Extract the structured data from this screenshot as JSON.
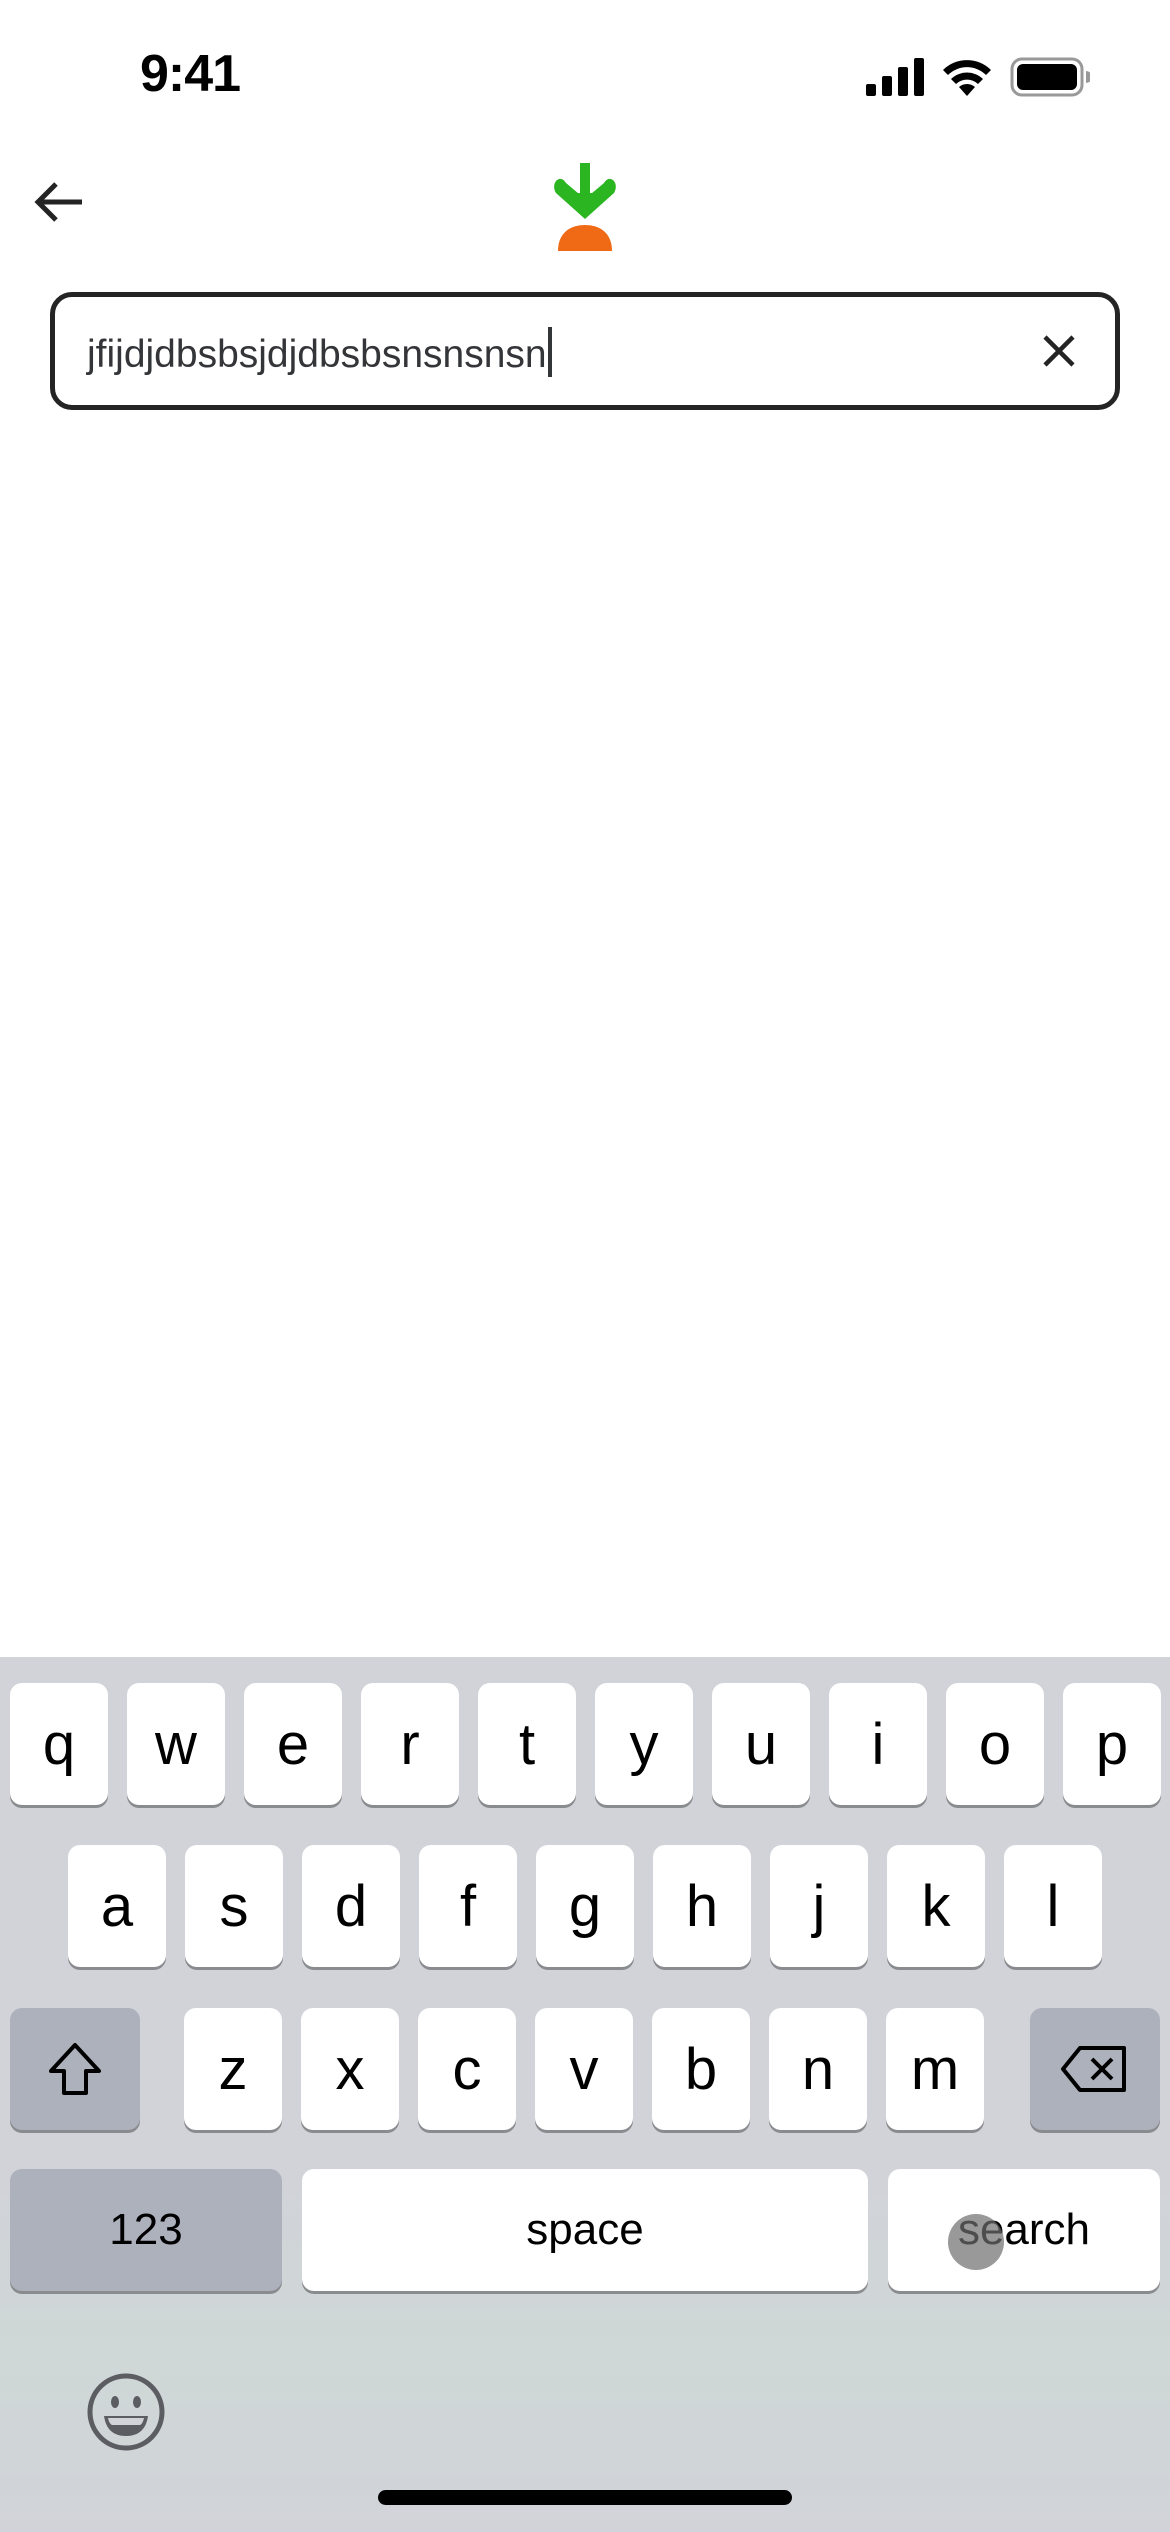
{
  "status_bar": {
    "time": "9:41",
    "icons": [
      "cellular-signal-icon",
      "wifi-icon",
      "battery-icon"
    ]
  },
  "header": {
    "back_icon": "arrow-left-icon",
    "logo": "carrot-logo"
  },
  "search": {
    "value": "jfijdjdbsbsjdjdbsbsnsnsnsn",
    "clear_icon": "close-icon",
    "border_color": "#242424"
  },
  "brand_colors": {
    "leaf": "#2ab521",
    "carrot": "#f06a15"
  },
  "keyboard": {
    "row1": [
      "q",
      "w",
      "e",
      "r",
      "t",
      "y",
      "u",
      "i",
      "o",
      "p"
    ],
    "row2": [
      "a",
      "s",
      "d",
      "f",
      "g",
      "h",
      "j",
      "k",
      "l"
    ],
    "row3": [
      "z",
      "x",
      "c",
      "v",
      "b",
      "n",
      "m"
    ],
    "shift_icon": "shift-icon",
    "backspace_icon": "backspace-icon",
    "numbers_label": "123",
    "space_label": "space",
    "search_label": "search",
    "emoji_icon": "emoji-icon"
  }
}
